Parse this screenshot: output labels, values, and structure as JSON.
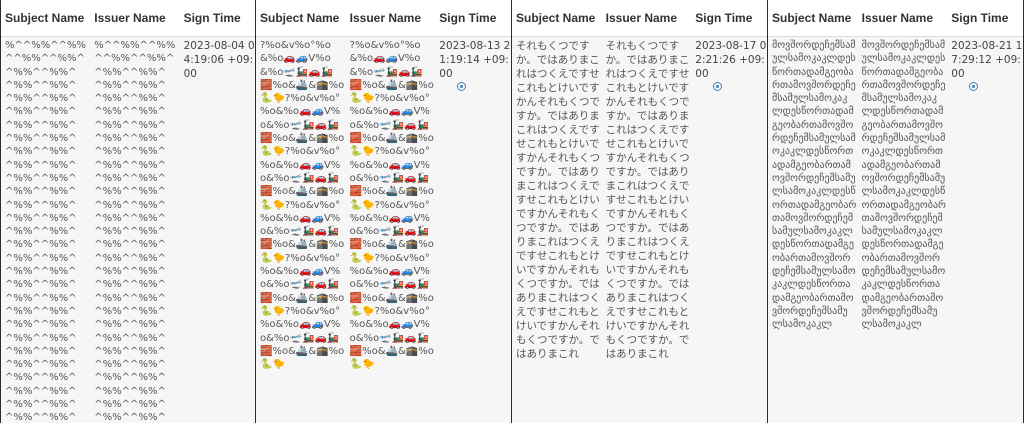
{
  "headers": {
    "subject": "Subject Name",
    "issuer": "Issuer Name",
    "sign_time": "Sign Time"
  },
  "panels": [
    {
      "subject": "%^^%%^^%%^^%%^^%%^^%%^^%%^^%%^^%%^^%%^^%%^^%%^^%%^^%%^^%%^^%%^^%%^^%%^^%%^^%%^^%%^^%%^^%%^^%%^^%%^^%%^^%%^^%%^^%%^^%%^^%%^^%%^^%%^^%%^^%%^^%%^^%%^^%%^^%%^^%%^^%%^^%%^^%%^^%%^^%%^^%%^^%%^^%%^^%%^^%%^^%%^^%%^^%%^^%%^^%%^^%%^^%%^^%%^^%%^^%%^^%%^^%%^^%%^^%%^^%%^^%%^^%%^^%%^^%%^^%%^^%%^^%%^^%%^^%%^^%%^^%%^^%%^^%%^^%%^^%%^^%%^^%%^^%%^^%%^^%%^^%%^^%%^^%%^^%%^^%%^^%%^^%%^^%%^^%%^^%%^^",
      "issuer": "%^^%%^^%%^^%%^^%%^^%%^^%%^^%%^^%%^^%%^^%%^^%%^^%%^^%%^^%%^^%%^^%%^^%%^^%%^^%%^^%%^^%%^^%%^^%%^^%%^^%%^^%%^^%%^^%%^^%%^^%%^^%%^^%%^^%%^^%%^^%%^^%%^^%%^^%%^^%%^^%%^^%%^^%%^^%%^^%%^^%%^^%%^^%%^^%%^^%%^^%%^^%%^^%%^^%%^^%%^^%%^^%%^^%%^^%%^^%%^^%%^^%%^^%%^^%%^^%%^^%%^^%%^^%%^^%%^^%%^^%%^^%%^^%%^^%%^^%%^^%%^^%%^^%%^^%%^^%%^^%%^^%%^^%%^^%%^^%%^^%%^^%%^^%%^^%%^^%%^^%%^^%%^^%%^^%%^^%%^^%%^^%%^^",
      "sign_time": "2023-08-04 04:19:06 +09:00"
    },
    {
      "subject": "?%o&v%o°%o&%o🚗🚙V%o&%o🛫🚂🚗🚂🧱%o&🚢&🕋%o🐍🐤?%o&v%o°%o&%o🚗🚙V%o&%o🛫🚂🚗🚂🧱%o&🚢&🕋%o🐍🐤?%o&v%o°%o&%o🚗🚙V%o&%o🛫🚂🚗🚂🧱%o&🚢&🕋%o🐍🐤?%o&v%o°%o&%o🚗🚙V%o&%o🛫🚂🚗🚂🧱%o&🚢&🕋%o🐍🐤?%o&v%o°%o&%o🚗🚙V%o&%o🛫🚂🚗🚂🧱%o&🚢&🕋%o🐍🐤?%o&v%o°%o&%o🚗🚙V%o&%o🛫🚂🚗🚂🧱%o&🚢&🕋%o🐍🐤",
      "issuer": "?%o&v%o°%o&%o🚗🚙V%o&%o🛫🚂🚗🚂🧱%o&🚢&🕋%o🐍🐤?%o&v%o°%o&%o🚗🚙V%o&%o🛫🚂🚗🚂🧱%o&🚢&🕋%o🐍🐤?%o&v%o°%o&%o🚗🚙V%o&%o🛫🚂🚗🚂🧱%o&🚢&🕋%o🐍🐤?%o&v%o°%o&%o🚗🚙V%o&%o🛫🚂🚗🚂🧱%o&🚢&🕋%o🐍🐤?%o&v%o°%o&%o🚗🚙V%o&%o🛫🚂🚗🚂🧱%o&🚢&🕋%o🐍🐤?%o&v%o°%o&%o🚗🚙V%o&%o🛫🚂🚗🚂🧱%o&🚢&🕋%o🐍🐤",
      "sign_time": "2023-08-13 21:19:14 +09:00"
    },
    {
      "subject": "それもくつですか。ではありまこれはつくえですせこれもとけいですかんそれもくつですか。ではありまこれはつくえですせこれもとけいですかんそれもくつですか。ではありまこれはつくえですせこれもとけいですかんそれもくつですか。ではありまこれはつくえですせこれもとけいですかんそれもくつですか。ではありまこれはつくえですせこれもとけいですかんそれもくつですか。ではありまこれ",
      "issuer": "それもくつですか。ではありまこれはつくえですせこれもとけいですかんそれもくつですか。ではありまこれはつくえですせこれもとけいですかんそれもくつですか。ではありまこれはつくえですせこれもとけいですかんそれもくつですか。ではありまこれはつくえですせこれもとけいですかんそれもくつですか。ではありまこれはつくえですせこれもとけいですかんそれもくつですか。ではありまこれ",
      "sign_time": "2023-08-17 02:21:26 +09:00"
    },
    {
      "subject": "მოვშორდეჩემსამულსამოკაკლდესწორთადამგეობართამოვშორდეჩემსამულსამოკაკლდესწორთადამგეობართამოვშორდეჩემსამულსამოკაკლდესწორთადამგეობართამოვშორდეჩემსამულსამოკაკლდესწორთადამგეობართამოვშორდეჩემსამულსამოკაკლდესწორთადამგეობართამოვშორდეჩემსამულსამოკაკლდესწორთადამგეობართამოვშორდეჩემსამულსამოკაკლ",
      "issuer": "მოვშორდეჩემსამულსამოკაკლდესწორთადამგეობართამოვშორდეჩემსამულსამოკაკლდესწორთადამგეობართამოვშორდეჩემსამულსამოკაკლდესწორთადამგეობართამოვშორდეჩემსამულსამოკაკლდესწორთადამგეობართამოვშორდეჩემსამულსამოკაკლდესწორთადამგეობართამოვშორდეჩემსამულსამოკაკლდესწორთადამგეობართამოვშორდეჩემსამულსამოკაკლ",
      "sign_time": "2023-08-21 17:29:12 +09:00"
    }
  ]
}
